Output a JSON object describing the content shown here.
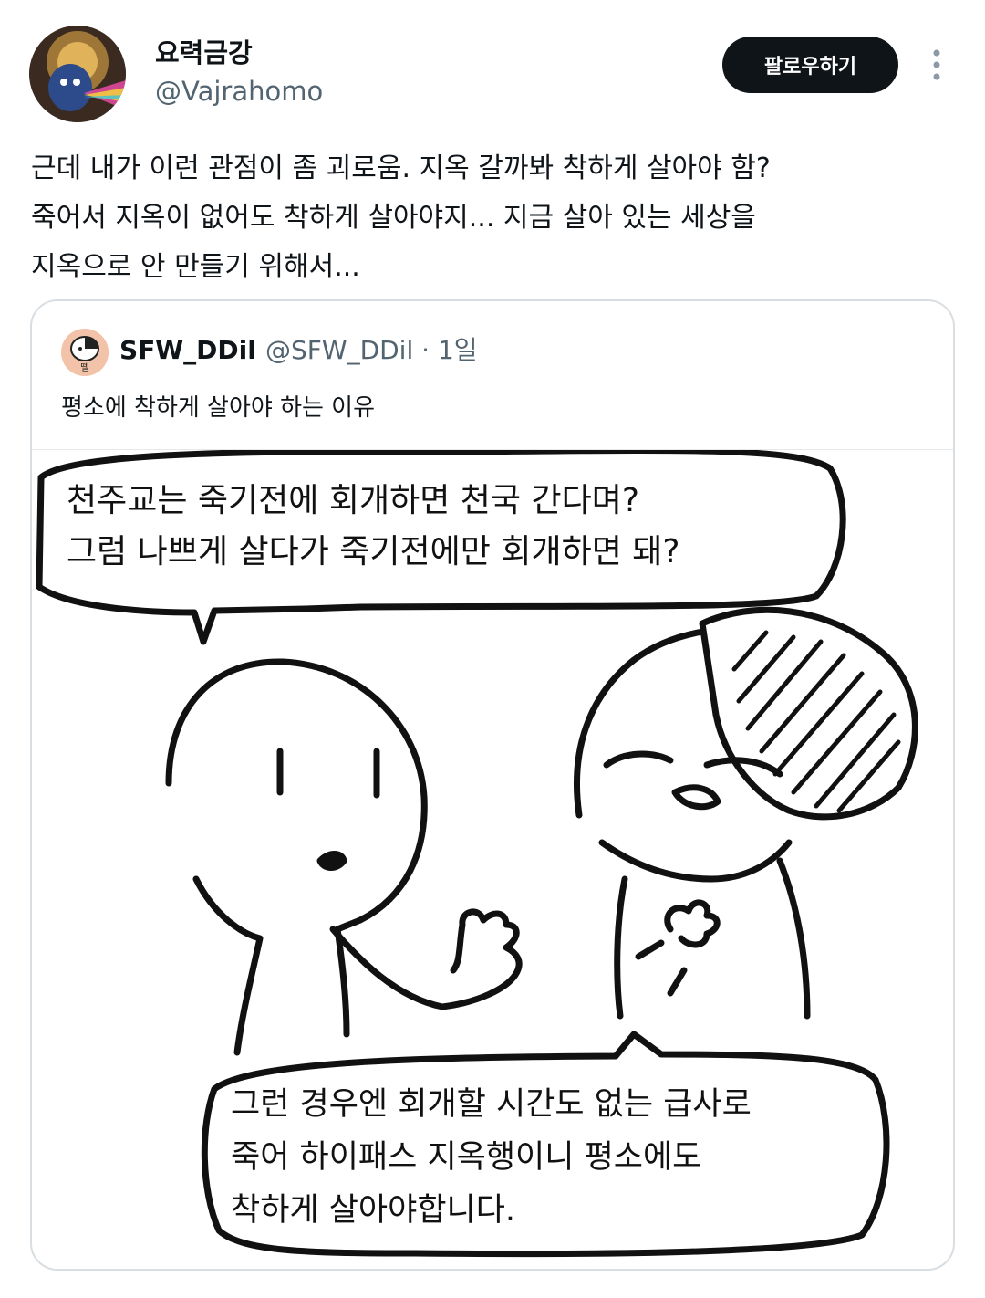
{
  "author": {
    "display_name": "요력금강",
    "handle": "@Vajrahomo"
  },
  "follow_label": "팔로우하기",
  "tweet_lines": [
    "근데 내가 이런 관점이 좀 괴로움. 지옥 갈까봐 착하게 살아야 함?",
    "죽어서 지옥이 없어도 착하게 살아야지... 지금 살아 있는 세상을",
    "지옥으로 안 만들기 위해서..."
  ],
  "quote": {
    "display_name": "SFW_DDil",
    "handle": "@SFW_DDil",
    "time": "1일",
    "text": "평소에 착하게 살아야 하는 이유",
    "avatar_label": "뗄",
    "comic": {
      "bubble_top": [
        "천주교는 죽기전에 회개하면 천국 간다며?",
        "그럼 나쁘게 살다가 죽기전에만 회개하면 돼?"
      ],
      "bubble_bottom": [
        "그런 경우엔 회개할 시간도 없는 급사로",
        "죽어 하이패스 지옥행이니 평소에도",
        "착하게 살아야합니다."
      ]
    }
  },
  "colors": {
    "follow_bg": "#0f1419",
    "secondary_text": "#536471",
    "card_border": "#d9dee3"
  },
  "icons": {
    "more": "more-vertical-icon"
  }
}
